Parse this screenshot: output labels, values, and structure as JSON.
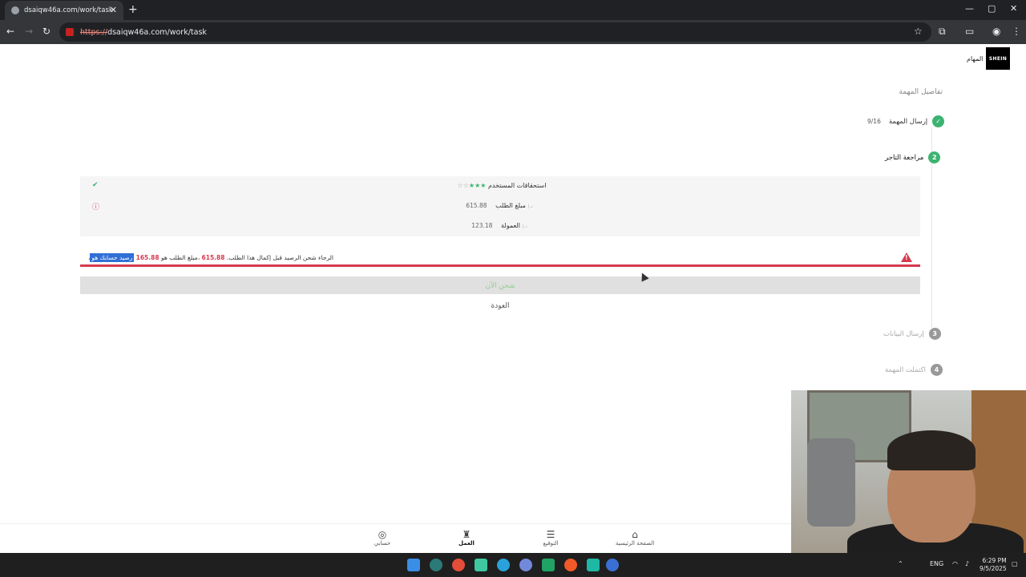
{
  "browser": {
    "tab_title": "dsaiqw46a.com/work/task",
    "url_scheme": "https://",
    "url_rest": "dsaiqw46a.com/work/task"
  },
  "header": {
    "logo_text": "SHEIN",
    "logo_label": "المهام"
  },
  "task": {
    "section_title": "تفاصيل المهمة",
    "steps": [
      {
        "number": "",
        "label": "إرسال المهمة",
        "count": "9/16",
        "status": "done"
      },
      {
        "number": "2",
        "label": "مراجعة التاجر",
        "status": "active"
      },
      {
        "number": "3",
        "label": "إرسال البيانات",
        "status": "pending"
      },
      {
        "number": "4",
        "label": "اكتملت المهمة",
        "status": "pending"
      }
    ],
    "rows": {
      "rights_label": "استحقاقات المستخدم",
      "stars_filled": 3,
      "stars_total": 5,
      "amount_label": "مبلغ الطلب",
      "amount_value": "615.88",
      "commission_label": "العمولة",
      "commission_value": "123.18",
      "currency": "د.إ"
    },
    "alert": {
      "highlight": "رصيد حسابك هو",
      "balance": "165.88",
      "middle": "،مبلغ الطلب هو",
      "order_amount": "615.88",
      "tail": "،الرجاء شحن الرصيد قبل إكمال هذا الطلب."
    },
    "charge_button": "شحن الآن",
    "back_link": "العودة"
  },
  "bottom_nav": [
    {
      "label": "حسابي",
      "icon": "user-icon",
      "active": false
    },
    {
      "label": "العمل",
      "icon": "work-icon",
      "active": true
    },
    {
      "label": "التوقيع",
      "icon": "list-icon",
      "active": false
    },
    {
      "label": "الصفحة الرئيسية",
      "icon": "home-icon",
      "active": false
    }
  ],
  "taskbar": {
    "lang": "ENG",
    "time": "6:29 PM",
    "date": "9/5/2025"
  },
  "colors": {
    "accent_green": "#3cb371",
    "alert_red": "#d6394e",
    "highlight_blue": "#2f6fd6"
  }
}
